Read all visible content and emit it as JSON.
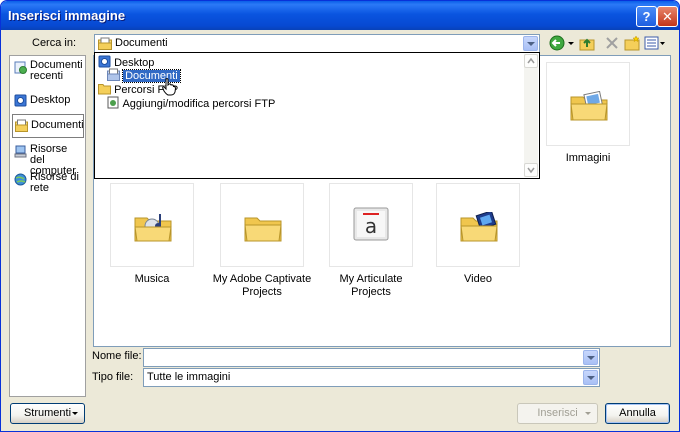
{
  "window": {
    "title": "Inserisci immagine"
  },
  "toolbar": {
    "look_in_label": "Cerca in:",
    "look_in_value": "Documenti"
  },
  "dropdown": {
    "items": [
      {
        "label": "Desktop",
        "icon": "desktop-icon"
      },
      {
        "label": "Documenti",
        "icon": "documents-folder-icon",
        "selected": true
      },
      {
        "label": "Percorsi FTP",
        "icon": "folder-icon"
      },
      {
        "label": "Aggiungi/modifica percorsi FTP",
        "icon": "ftp-edit-icon"
      }
    ]
  },
  "places": [
    {
      "label": "Documenti recenti",
      "icon": "recent-documents-icon"
    },
    {
      "label": "Desktop",
      "icon": "desktop-icon"
    },
    {
      "label": "Documenti",
      "icon": "documents-icon",
      "selected": true
    },
    {
      "label": "Risorse del computer",
      "icon": "computer-icon"
    },
    {
      "label": "Risorse di rete",
      "icon": "network-icon"
    }
  ],
  "files": [
    {
      "label": "Immagini",
      "icon": "pictures-folder-icon"
    },
    {
      "label": "Musica",
      "icon": "music-folder-icon"
    },
    {
      "label": "My Adobe Captivate Projects",
      "icon": "folder-icon"
    },
    {
      "label": "My Articulate Projects",
      "icon": "articulate-folder-icon"
    },
    {
      "label": "Video",
      "icon": "video-folder-icon"
    }
  ],
  "filename": {
    "label": "Nome file:",
    "value": ""
  },
  "filetype": {
    "label": "Tipo file:",
    "value": "Tutte le immagini"
  },
  "buttons": {
    "tools": "Strumenti",
    "insert": "Inserisci",
    "cancel": "Annulla"
  }
}
